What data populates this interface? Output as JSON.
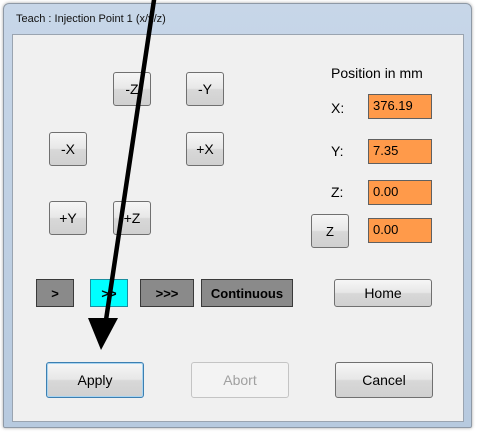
{
  "window": {
    "title": "Teach : Injection Point 1 (x/y/z)"
  },
  "jog": {
    "minus_z": "-Z",
    "minus_y": "-Y",
    "minus_x": "-X",
    "plus_x": "+X",
    "plus_y": "+Y",
    "plus_z": "+Z"
  },
  "position": {
    "heading": "Position in mm",
    "x_label": "X:",
    "x_value": "376.19",
    "y_label": "Y:",
    "y_value": "7.35",
    "z_label": "Z:",
    "z_value": "0.00",
    "z_button": "Z",
    "z2_value": "0.00",
    "field_color": "#ff9a4a"
  },
  "speed": {
    "slow": ">",
    "medium": ">>",
    "fast": ">>>",
    "continuous": "Continuous",
    "active_color": "#00ffff",
    "inactive_color": "#8a8a8a",
    "selected_index": 1
  },
  "actions": {
    "home": "Home",
    "apply": "Apply",
    "abort": "Abort",
    "cancel": "Cancel"
  }
}
